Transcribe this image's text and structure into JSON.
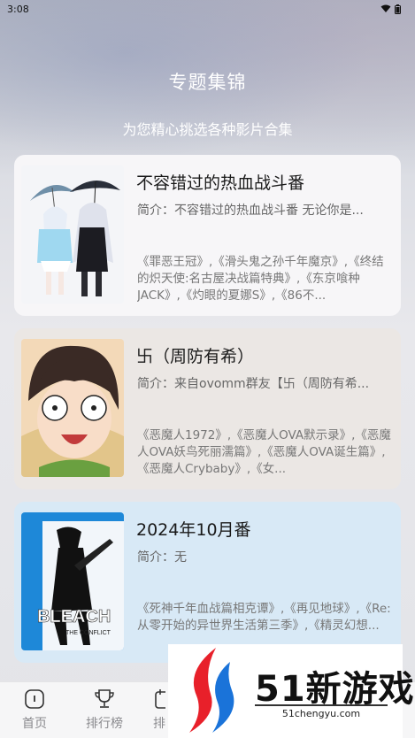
{
  "status_bar": {
    "time": "3:08"
  },
  "page": {
    "title": "专题集锦",
    "subtitle": "为您精心挑选各种影片合集"
  },
  "cards": [
    {
      "title": "不容错过的热血战斗番",
      "intro": "简介：不容错过的热血战斗番 无论你是...",
      "list": "《罪恶王冠》,《滑头鬼之孙千年魔京》,《终结的炽天使:名古屋决战篇特典》,《东京喰种JACK》,《灼眼的夏娜S》,《86不..."
    },
    {
      "title": "卐（周防有希）",
      "intro": "简介：来自ovomm群友【卐（周防有希...",
      "list": "《恶魔人1972》,《恶魔人OVA默示录》,《恶魔人OVA妖鸟死丽濡篇》,《恶魔人OVA诞生篇》,《恶魔人Crybaby》,《女..."
    },
    {
      "title": "2024年10月番",
      "intro": "简介：无",
      "list": "《死神千年血战篇相克谭》,《再见地球》,《Re:从零开始的异世界生活第三季》,《精灵幻想..."
    }
  ],
  "thumb3_text": {
    "logo": "BLEACH",
    "sub": "THE CONFLICT"
  },
  "tab_bar": {
    "home": "首页",
    "ranking": "排行榜",
    "third_partial": "排"
  },
  "watermark": {
    "brand": "51新游戏",
    "domain": "51chengyu.com"
  },
  "colors": {
    "accent_red": "#e8202a",
    "accent_blue": "#1a73d9"
  }
}
